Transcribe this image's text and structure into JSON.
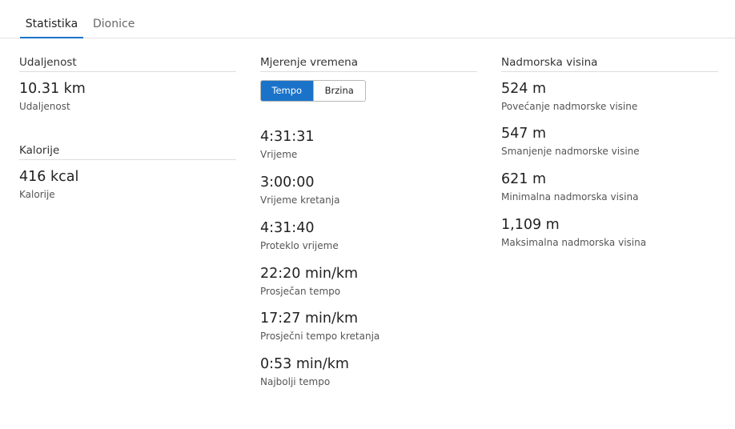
{
  "tabs": [
    {
      "label": "Statistika",
      "active": true
    },
    {
      "label": "Dionice",
      "active": false
    }
  ],
  "colors": {
    "accent": "#1a73c9"
  },
  "distance_section": {
    "title": "Udaljenost",
    "stats": [
      {
        "value": "10.31 km",
        "label": "Udaljenost"
      }
    ]
  },
  "calories_section": {
    "title": "Kalorije",
    "stats": [
      {
        "value": "416 kcal",
        "label": "Kalorije"
      }
    ]
  },
  "timing_section": {
    "title": "Mjerenje vremena",
    "toggle": {
      "options": [
        "Tempo",
        "Brzina"
      ],
      "selected": "Tempo"
    },
    "stats": [
      {
        "value": "4:31:31",
        "label": "Vrijeme"
      },
      {
        "value": "3:00:00",
        "label": "Vrijeme kretanja"
      },
      {
        "value": "4:31:40",
        "label": "Proteklo vrijeme"
      },
      {
        "value": "22:20 min/km",
        "label": "Prosječan tempo"
      },
      {
        "value": "17:27 min/km",
        "label": "Prosječni tempo kretanja"
      },
      {
        "value": "0:53 min/km",
        "label": "Najbolji tempo"
      }
    ]
  },
  "elevation_section": {
    "title": "Nadmorska visina",
    "stats": [
      {
        "value": "524 m",
        "label": "Povećanje nadmorske visine"
      },
      {
        "value": "547 m",
        "label": "Smanjenje nadmorske visine"
      },
      {
        "value": "621 m",
        "label": "Minimalna nadmorska visina"
      },
      {
        "value": "1,109 m",
        "label": "Maksimalna nadmorska visina"
      }
    ]
  }
}
